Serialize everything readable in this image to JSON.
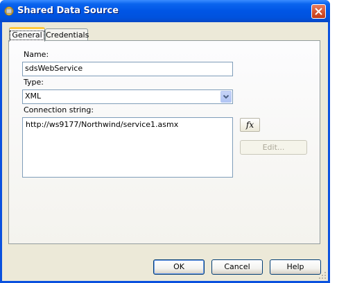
{
  "window": {
    "title": "Shared Data Source",
    "close_icon": "close-icon"
  },
  "tabs": [
    {
      "label": "General",
      "active": true
    },
    {
      "label": "Credentials",
      "active": false
    }
  ],
  "form": {
    "name_label": "Name:",
    "name_value": "sdsWebService",
    "type_label": "Type:",
    "type_value": "XML",
    "connection_label": "Connection string:",
    "connection_value": "http://ws9177/Northwind/service1.asmx",
    "fx_label": "fx",
    "edit_label": "Edit..."
  },
  "buttons": {
    "ok": "OK",
    "cancel": "Cancel",
    "help": "Help"
  },
  "colors": {
    "titlebar": "#0055e5",
    "client_bg": "#ece9d8",
    "close_red": "#d5532f"
  }
}
